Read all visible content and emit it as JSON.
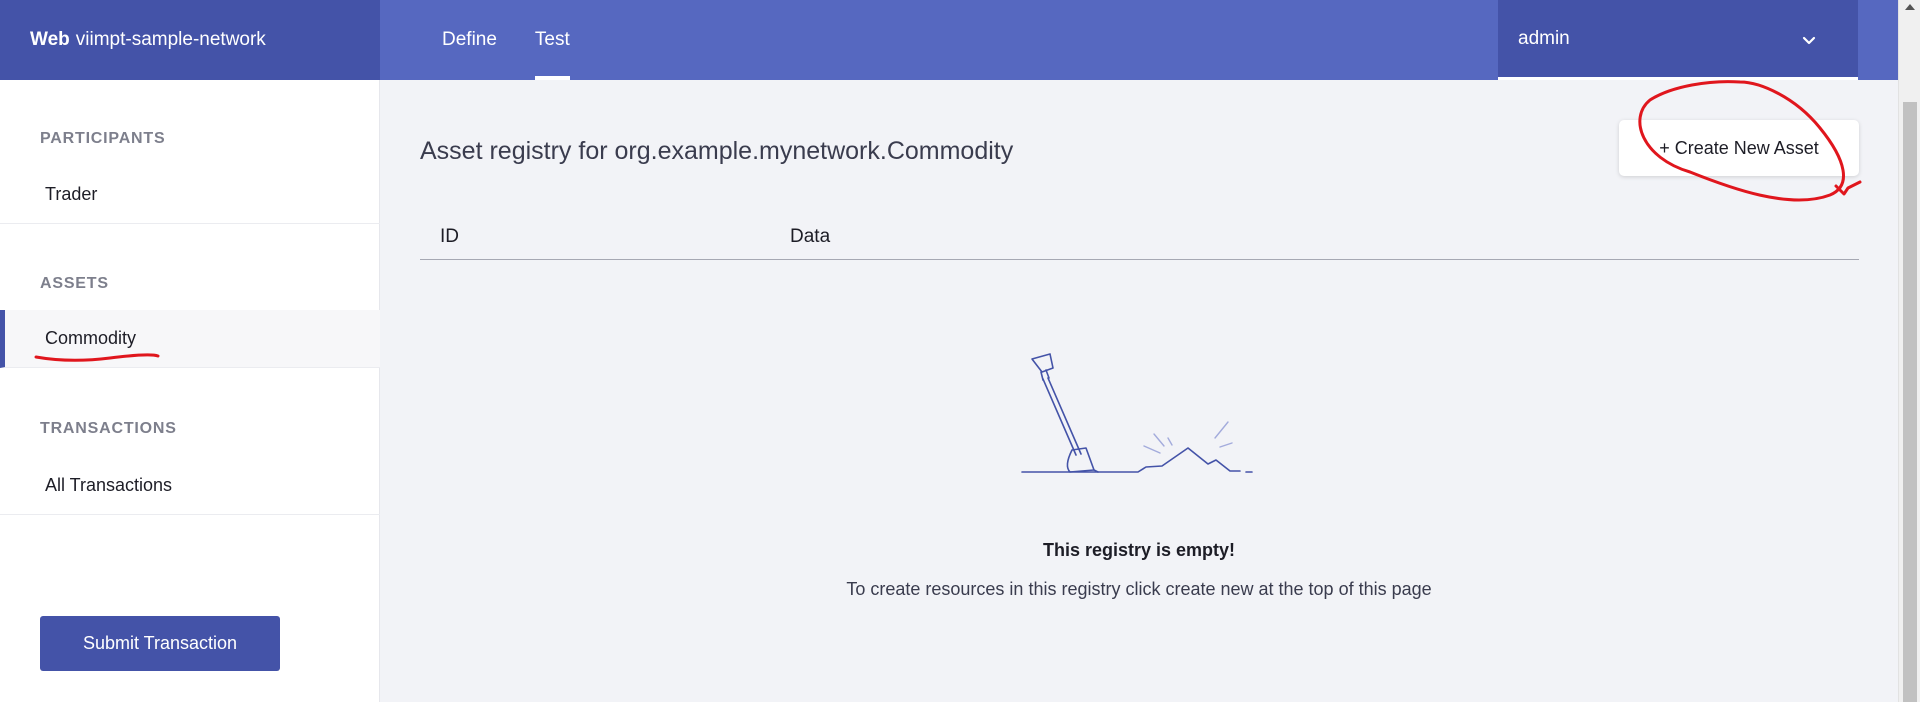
{
  "header": {
    "brand_bold": "Web",
    "brand_name": "viimpt-sample-network",
    "tabs": [
      {
        "label": "Define",
        "active": false
      },
      {
        "label": "Test",
        "active": true
      }
    ],
    "user": "admin"
  },
  "sidebar": {
    "participants_heading": "PARTICIPANTS",
    "participants": [
      {
        "label": "Trader"
      }
    ],
    "assets_heading": "ASSETS",
    "assets": [
      {
        "label": "Commodity",
        "active": true
      }
    ],
    "transactions_heading": "TRANSACTIONS",
    "transactions": [
      {
        "label": "All Transactions"
      }
    ],
    "submit_label": "Submit Transaction"
  },
  "main": {
    "title": "Asset registry for org.example.mynetwork.Commodity",
    "create_label": "+ Create New Asset",
    "columns": [
      "ID",
      "Data"
    ],
    "empty_title": "This registry is empty!",
    "empty_message": "To create resources in this registry click create new at the top of this page"
  },
  "colors": {
    "topbar": "#5668c0",
    "topbar_dark": "#4453a8",
    "accent": "#4453a8",
    "annotation": "#e0161d"
  },
  "icons": [
    "chevron-down-icon",
    "shovel-icon"
  ]
}
